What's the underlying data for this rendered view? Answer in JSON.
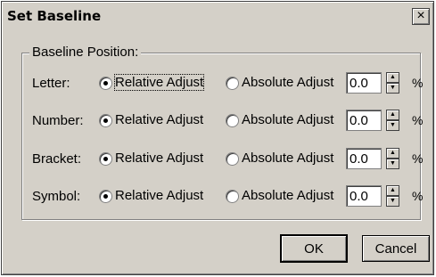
{
  "dialog": {
    "title": "Set Baseline",
    "close_glyph": "×"
  },
  "group": {
    "label": "Baseline Position:"
  },
  "rows": [
    {
      "label": "Letter:",
      "relative_label": "Relative Adjust",
      "absolute_label": "Absolute Adjust",
      "selected": "relative",
      "value": "0.0",
      "unit": "%"
    },
    {
      "label": "Number:",
      "relative_label": "Relative Adjust",
      "absolute_label": "Absolute Adjust",
      "selected": "relative",
      "value": "0.0",
      "unit": "%"
    },
    {
      "label": "Bracket:",
      "relative_label": "Relative Adjust",
      "absolute_label": "Absolute Adjust",
      "selected": "relative",
      "value": "0.0",
      "unit": "%"
    },
    {
      "label": "Symbol:",
      "relative_label": "Relative Adjust",
      "absolute_label": "Absolute Adjust",
      "selected": "relative",
      "value": "0.0",
      "unit": "%"
    }
  ],
  "buttons": {
    "ok": "OK",
    "cancel": "Cancel"
  },
  "icons": {
    "spin_up": "up-arrow-icon",
    "spin_down": "down-arrow-icon"
  }
}
